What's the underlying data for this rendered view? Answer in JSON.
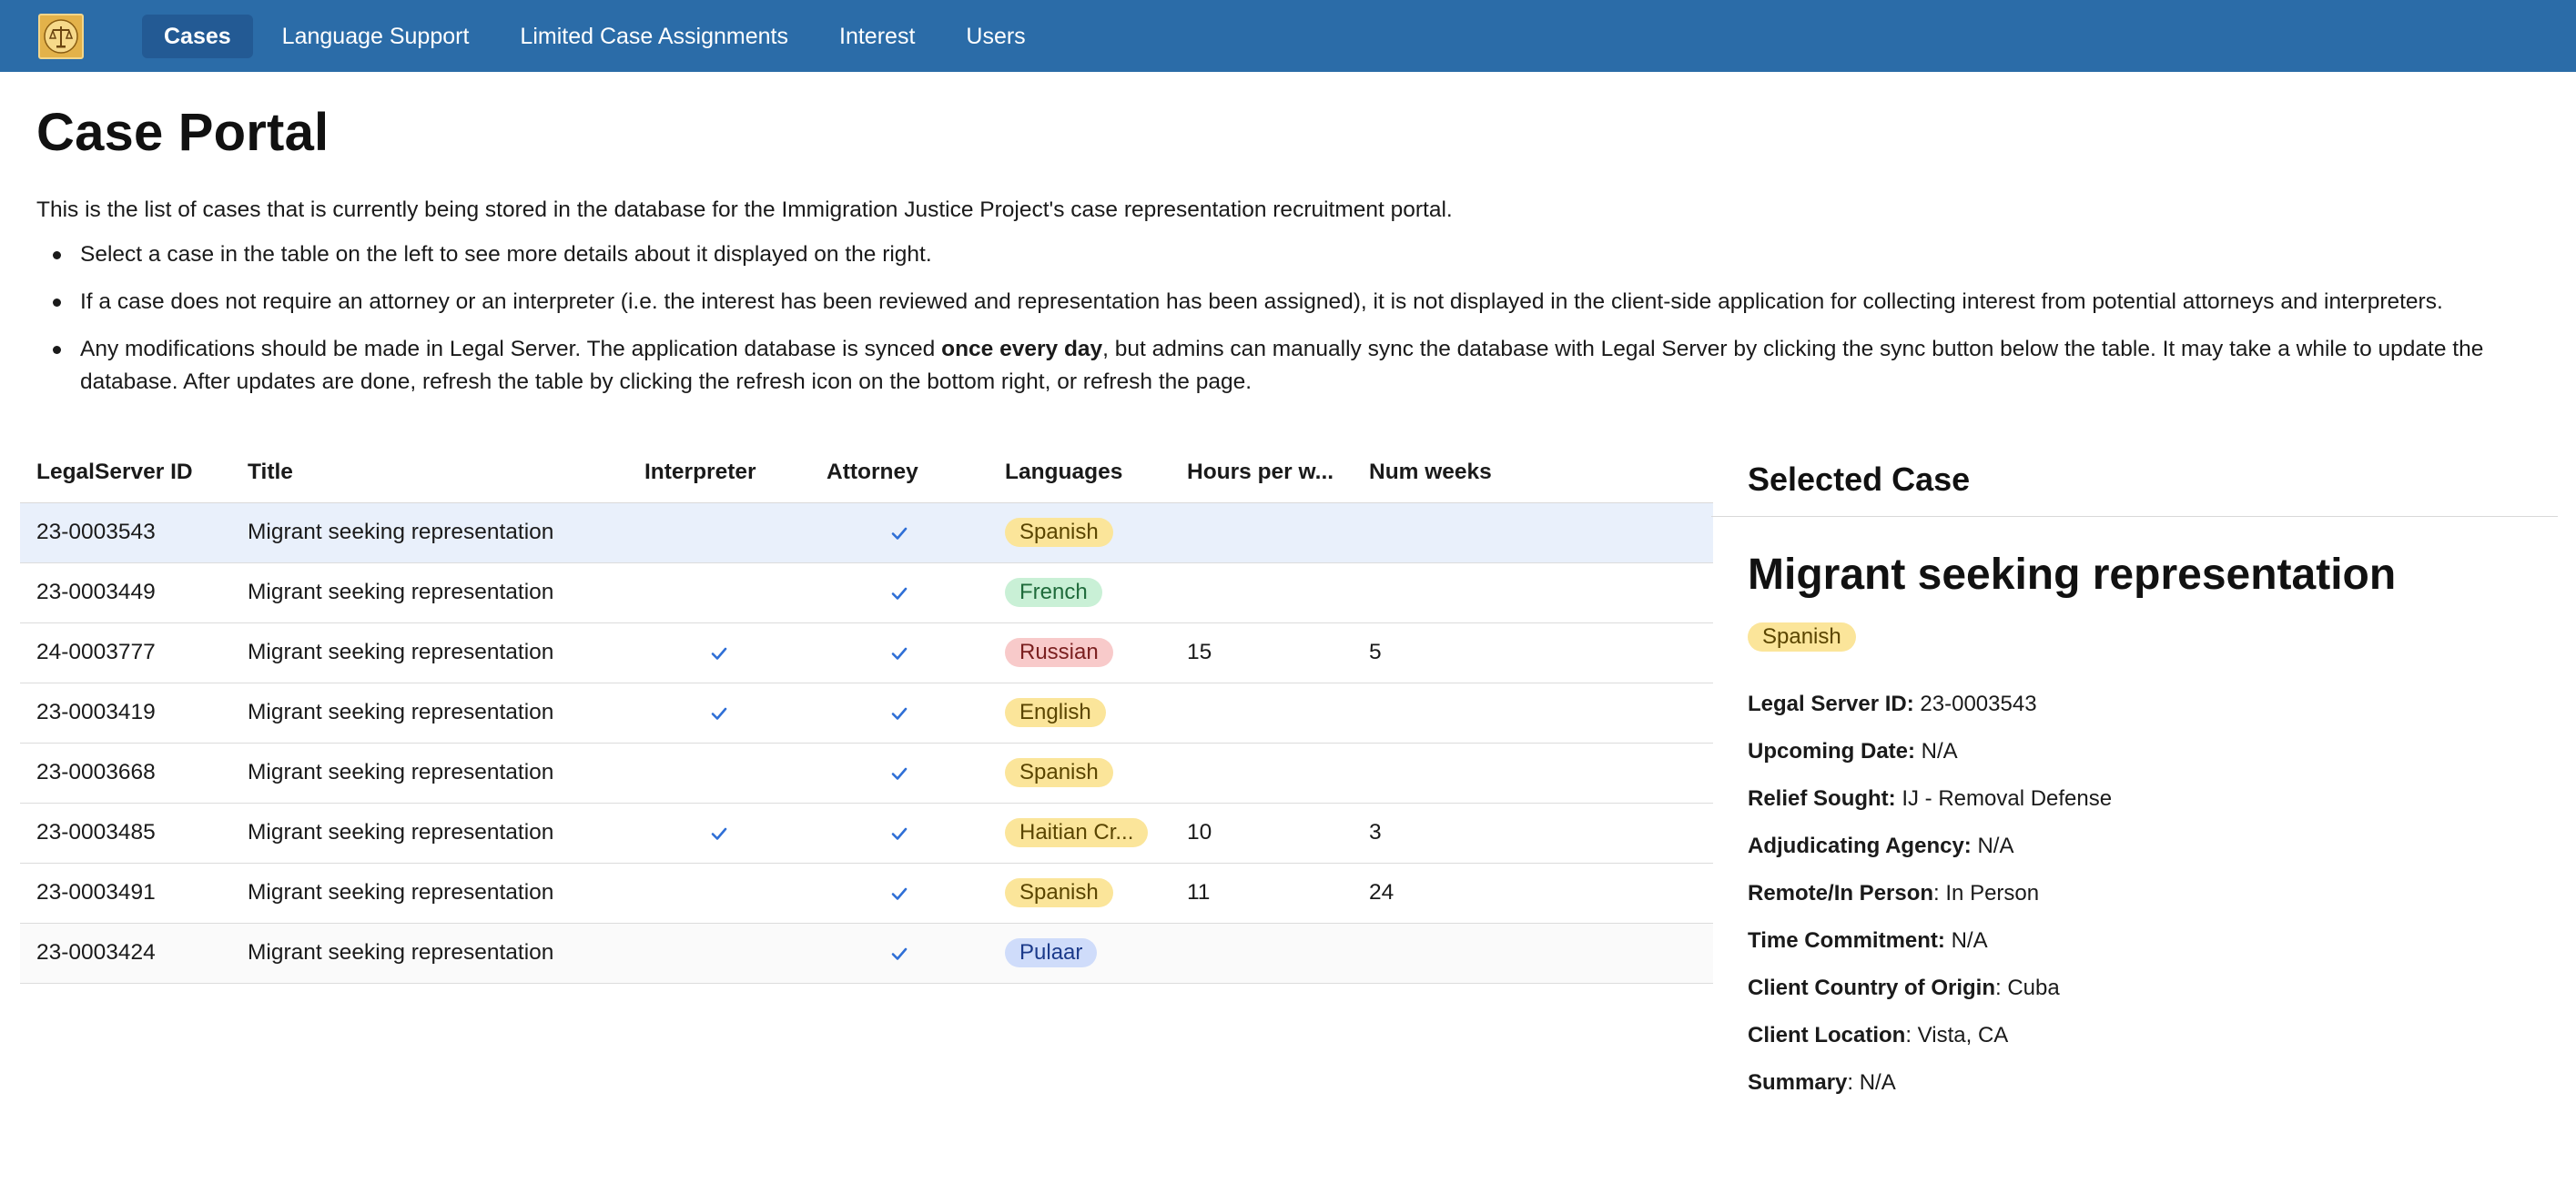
{
  "nav": {
    "tabs": [
      {
        "label": "Cases",
        "active": true
      },
      {
        "label": "Language Support",
        "active": false
      },
      {
        "label": "Limited Case Assignments",
        "active": false
      },
      {
        "label": "Interest",
        "active": false
      },
      {
        "label": "Users",
        "active": false
      }
    ],
    "bar_color": "#2b6ca8"
  },
  "page": {
    "title": "Case Portal",
    "intro": "This is the list of cases that is currently being stored in the database for the Immigration Justice Project's case representation recruitment portal.",
    "bullets": [
      {
        "text": "Select a case in the table on the left to see more details about it displayed on the right."
      },
      {
        "text": "If a case does not require an attorney or an interpreter (i.e. the interest has been reviewed and representation has been assigned), it is not displayed in the client-side application for collecting interest from potential attorneys and interpreters."
      },
      {
        "before": "Any modifications should be made in Legal Server. The application database is synced ",
        "bold": "once every day",
        "after": ", but admins can manually sync the database with Legal Server by clicking the sync button below the table. It may take a while to update the database. After updates are done, refresh the table by clicking the refresh icon on the bottom right, or refresh the page."
      }
    ]
  },
  "table": {
    "columns": [
      "LegalServer ID",
      "Title",
      "Interpreter",
      "Attorney",
      "Languages",
      "Hours per w...",
      "Num weeks"
    ],
    "rows": [
      {
        "id": "23-0003543",
        "title": "Migrant seeking representation",
        "interpreter": false,
        "attorney": true,
        "language": "Spanish",
        "hours": "",
        "weeks": ""
      },
      {
        "id": "23-0003449",
        "title": "Migrant seeking representation",
        "interpreter": false,
        "attorney": true,
        "language": "French",
        "hours": "",
        "weeks": ""
      },
      {
        "id": "24-0003777",
        "title": "Migrant seeking representation",
        "interpreter": true,
        "attorney": true,
        "language": "Russian",
        "hours": "15",
        "weeks": "5"
      },
      {
        "id": "23-0003419",
        "title": "Migrant seeking representation",
        "interpreter": true,
        "attorney": true,
        "language": "English",
        "hours": "",
        "weeks": ""
      },
      {
        "id": "23-0003668",
        "title": "Migrant seeking representation",
        "interpreter": false,
        "attorney": true,
        "language": "Spanish",
        "hours": "",
        "weeks": ""
      },
      {
        "id": "23-0003485",
        "title": "Migrant seeking representation",
        "interpreter": true,
        "attorney": true,
        "language": "Haitian Cr...",
        "hours": "10",
        "weeks": "3"
      },
      {
        "id": "23-0003491",
        "title": "Migrant seeking representation",
        "interpreter": false,
        "attorney": true,
        "language": "Spanish",
        "hours": "11",
        "weeks": "24"
      },
      {
        "id": "23-0003424",
        "title": "Migrant seeking representation",
        "interpreter": false,
        "attorney": true,
        "language": "Pulaar",
        "hours": "",
        "weeks": ""
      }
    ],
    "selected_index": 0,
    "check_color": "#2f6fd6"
  },
  "language_colors": {
    "Spanish": {
      "bg": "#fbe59a",
      "fg": "#5a4500"
    },
    "French": {
      "bg": "#c9f0d6",
      "fg": "#1f6b3b"
    },
    "Russian": {
      "bg": "#f8caca",
      "fg": "#7a1f1f"
    },
    "English": {
      "bg": "#fbe59a",
      "fg": "#5a4500"
    },
    "Haitian Cr...": {
      "bg": "#fbe59a",
      "fg": "#5a4500"
    },
    "Pulaar": {
      "bg": "#cfdcfa",
      "fg": "#1b3a8a"
    }
  },
  "panel": {
    "heading": "Selected Case",
    "case_title": "Migrant seeking representation",
    "language": "Spanish",
    "details": [
      {
        "label": "Legal Server ID:",
        "value": " 23-0003543"
      },
      {
        "label": "Upcoming Date:",
        "value": " N/A"
      },
      {
        "label": "Relief Sought:",
        "value": " IJ - Removal Defense"
      },
      {
        "label": "Adjudicating Agency:",
        "value": " N/A"
      },
      {
        "label": "Remote/In Person",
        "value": ": In Person"
      },
      {
        "label": "Time Commitment:",
        "value": " N/A"
      },
      {
        "label": "Client Country of Origin",
        "value": ": Cuba"
      },
      {
        "label": "Client Location",
        "value": ": Vista, CA"
      },
      {
        "label": "Summary",
        "value": ": N/A"
      }
    ]
  }
}
